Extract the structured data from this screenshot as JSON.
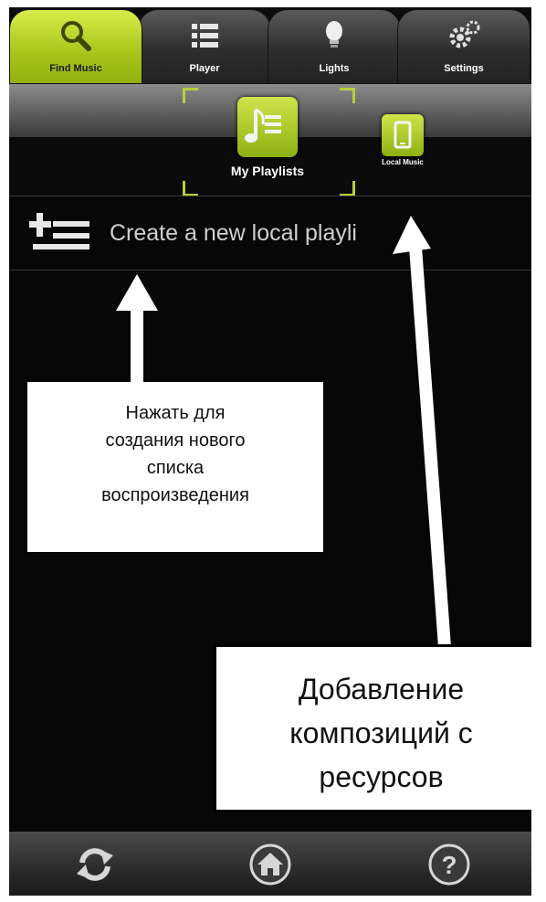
{
  "tabs": [
    {
      "label": "Find Music",
      "icon": "search-icon",
      "active": true
    },
    {
      "label": "Player",
      "icon": "list-icon",
      "active": false
    },
    {
      "label": "Lights",
      "icon": "lightbulb-icon",
      "active": false
    },
    {
      "label": "Settings",
      "icon": "gear-icon",
      "active": false
    }
  ],
  "sources": {
    "playlists_label": "My Playlists",
    "local_label": "Local Music"
  },
  "create_row": {
    "label": "Create a new local playli"
  },
  "annotations": {
    "create_note": [
      "Нажать для",
      "создания нового",
      "списка",
      "воспроизведения"
    ],
    "add_note": [
      "Добавление",
      "композиций с",
      "ресурсов"
    ]
  },
  "bottom_bar": {
    "icons": [
      "refresh-icon",
      "home-icon",
      "help-icon"
    ]
  },
  "colors": {
    "accent": "#a8c41a",
    "background": "#070707",
    "annotation_bg": "#ffffff"
  }
}
